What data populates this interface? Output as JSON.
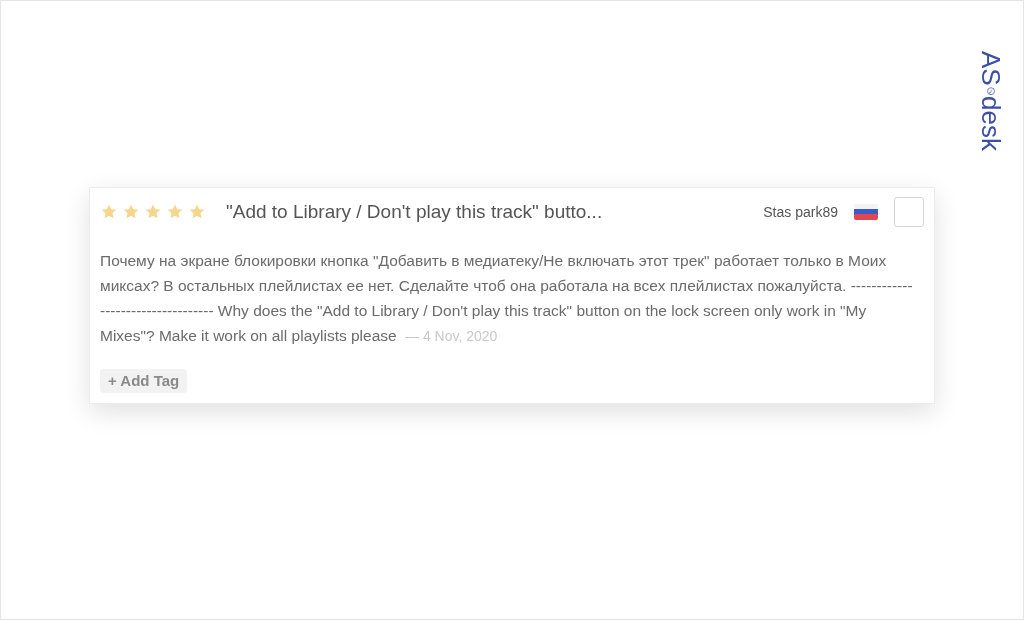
{
  "logo": {
    "prefix": "AS",
    "suffix": "desk"
  },
  "review": {
    "stars": 5,
    "title": "\"Add to Library / Don't play this track\" butto...",
    "author": "Stas park89",
    "selected": false,
    "body": "Почему на экране блокировки кнопка \"Добавить в медиатеку/Не включать этот трек\" работает только в Моих миксах? В остальных плейлистах ее нет. Сделайте чтоб она работала на всех плейлистах пожалуйста. ---------------------------------- Why does the \"Add to Library / Don't play this track\" button on the lock screen only work in \"My Mixes\"? Make it work on all playlists please",
    "date": "— 4 Nov, 2020",
    "tag_button": "+ Add Tag"
  }
}
